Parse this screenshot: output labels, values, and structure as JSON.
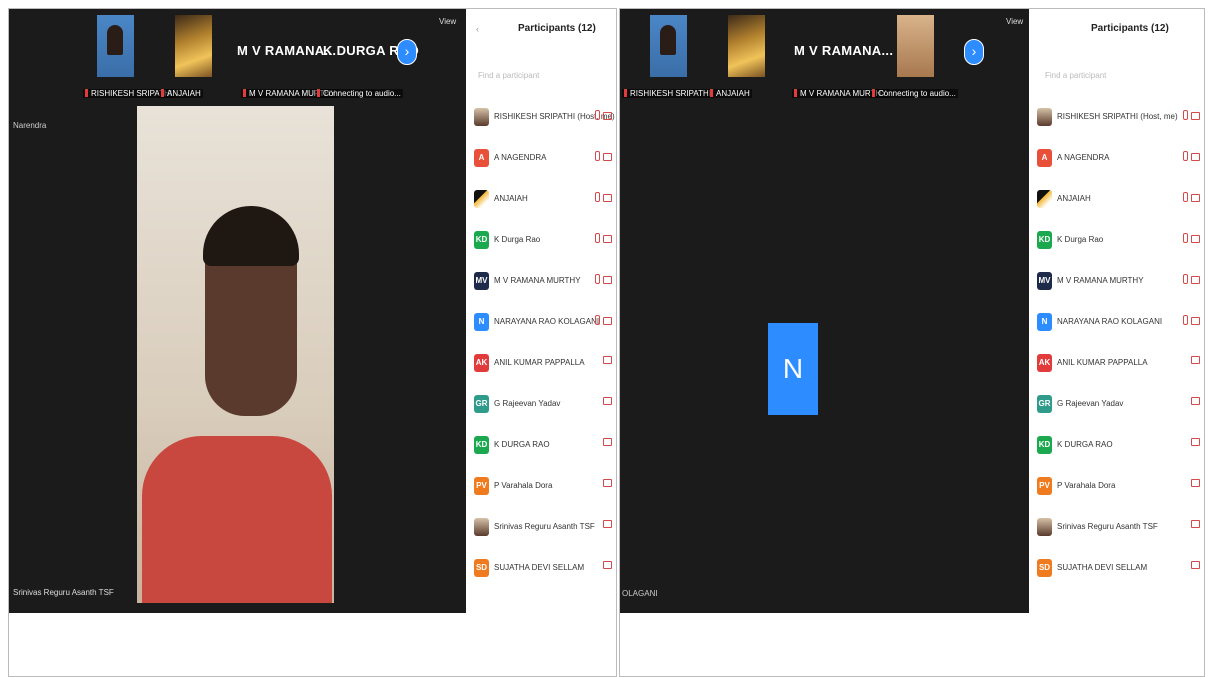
{
  "colors": {
    "zoom_blue": "#2d8cff",
    "video_bg": "#1b1b1b",
    "muted_red": "#d24a4a"
  },
  "panel1": {
    "thumbnail_names": [
      "M V RAMANA...",
      "K DURGA RAO"
    ],
    "thumbnail_captions": [
      "RISHIKESH SRIPATHI",
      "ANJAIAH",
      "M V RAMANA MURTHY",
      "Connecting to audio..."
    ],
    "view_button": "View",
    "speaker_label": "Narendra",
    "bottom_name": "Srinivas Reguru Asanth TSF",
    "participants": {
      "title": "Participants (12)",
      "search_placeholder": "Find a participant",
      "items": [
        {
          "initials": "",
          "name": "RISHIKESH SRIPATHI (Host, me)",
          "color": "#ffffff",
          "photo": true
        },
        {
          "initials": "A",
          "name": "A NAGENDRA",
          "color": "#e8503a"
        },
        {
          "initials": "",
          "name": "ANJAIAH",
          "color": "#ffffff",
          "photo2": true
        },
        {
          "initials": "KD",
          "name": "K Durga Rao",
          "color": "#1ba84f"
        },
        {
          "initials": "MV",
          "name": "M V RAMANA MURTHY",
          "color": "#1e2a4a"
        },
        {
          "initials": "N",
          "name": "NARAYANA RAO KOLAGANI",
          "color": "#2d8cff"
        },
        {
          "initials": "AK",
          "name": "ANIL KUMAR PAPPALLA",
          "color": "#e23b3b"
        },
        {
          "initials": "GR",
          "name": "G Rajeevan Yadav",
          "color": "#2f9b8a"
        },
        {
          "initials": "KD",
          "name": "K DURGA RAO",
          "color": "#1ba84f"
        },
        {
          "initials": "PV",
          "name": "P Varahala Dora",
          "color": "#f07a1e"
        },
        {
          "initials": "",
          "name": "Srinivas Reguru Asanth TSF",
          "color": "#ffffff",
          "photo": true
        },
        {
          "initials": "SD",
          "name": "SUJATHA DEVI SELLAM",
          "color": "#f07a1e"
        }
      ]
    }
  },
  "panel2": {
    "thumbnail_names": [
      "M V RAMANA..."
    ],
    "thumbnail_captions": [
      "RISHIKESH SRIPATHI",
      "ANJAIAH",
      "M V RAMANA MURTHY",
      "Connecting to audio..."
    ],
    "view_button": "View",
    "tile_initial": "N",
    "bottom_name": "OLAGANI",
    "participants": {
      "title": "Participants (12)",
      "search_placeholder": "Find a participant",
      "items": [
        {
          "initials": "",
          "name": "RISHIKESH SRIPATHI (Host, me)",
          "color": "#ffffff",
          "photo": true
        },
        {
          "initials": "A",
          "name": "A NAGENDRA",
          "color": "#e8503a"
        },
        {
          "initials": "",
          "name": "ANJAIAH",
          "color": "#ffffff",
          "photo2": true
        },
        {
          "initials": "KD",
          "name": "K Durga Rao",
          "color": "#1ba84f"
        },
        {
          "initials": "MV",
          "name": "M V RAMANA MURTHY",
          "color": "#1e2a4a"
        },
        {
          "initials": "N",
          "name": "NARAYANA RAO KOLAGANI",
          "color": "#2d8cff"
        },
        {
          "initials": "AK",
          "name": "ANIL KUMAR PAPPALLA",
          "color": "#e23b3b"
        },
        {
          "initials": "GR",
          "name": "G Rajeevan Yadav",
          "color": "#2f9b8a"
        },
        {
          "initials": "KD",
          "name": "K DURGA RAO",
          "color": "#1ba84f"
        },
        {
          "initials": "PV",
          "name": "P Varahala Dora",
          "color": "#f07a1e"
        },
        {
          "initials": "",
          "name": "Srinivas Reguru Asanth TSF",
          "color": "#ffffff",
          "photo": true
        },
        {
          "initials": "SD",
          "name": "SUJATHA DEVI SELLAM",
          "color": "#f07a1e"
        }
      ]
    }
  }
}
